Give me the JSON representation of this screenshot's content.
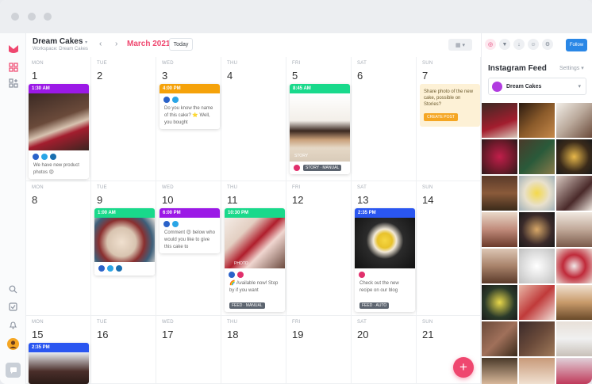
{
  "header": {
    "brand": "Dream Cakes",
    "workspace": "Workspace: Dream Cakes",
    "month": "March 2021",
    "today_label": "Today",
    "grid_icon": "grid-icon",
    "follow_label": "Follow"
  },
  "calendar": {
    "row1": {
      "mon": {
        "wd": "MON",
        "day": "1"
      },
      "tue": {
        "wd": "TUE",
        "day": "2"
      },
      "wed": {
        "wd": "WED",
        "day": "3"
      },
      "thu": {
        "wd": "THU",
        "day": "4"
      },
      "fri": {
        "wd": "FRI",
        "day": "5"
      },
      "sat": {
        "wd": "SAT",
        "day": "6"
      },
      "sun": {
        "wd": "SUN",
        "day": "7"
      }
    },
    "row2": {
      "mon": {
        "wd": "MON",
        "day": "8"
      },
      "tue": {
        "wd": "TUE",
        "day": "9"
      },
      "wed": {
        "wd": "WED",
        "day": "10"
      },
      "thu": {
        "wd": "THU",
        "day": "11"
      },
      "fri": {
        "wd": "FRI",
        "day": "12"
      },
      "sat": {
        "wd": "SAT",
        "day": "13"
      },
      "sun": {
        "wd": "SUN",
        "day": "14"
      }
    },
    "row3": {
      "mon": {
        "wd": "MON",
        "day": "15"
      },
      "tue": {
        "wd": "TUE",
        "day": "16"
      },
      "wed": {
        "wd": "WED",
        "day": "17"
      },
      "thu": {
        "wd": "THU",
        "day": "18"
      },
      "fri": {
        "wd": "FRI",
        "day": "19"
      },
      "sat": {
        "wd": "SAT",
        "day": "20"
      },
      "sun": {
        "wd": "SUN",
        "day": "21"
      }
    }
  },
  "posts": {
    "p1": {
      "time": "1:30 AM",
      "color": "#9b19e6",
      "caption": "We have new product photos 😍"
    },
    "p2": {
      "time": "4:00 PM",
      "color": "#f5a20a",
      "caption": "Do you know the name of this cake? ⭐ Well, you bought"
    },
    "p3": {
      "time": "8:45 AM",
      "color": "#19d98b",
      "badge": "STORY · MANUAL",
      "overlay": "STORY"
    },
    "p4": {
      "time": "1:00 AM",
      "color": "#19d98b"
    },
    "p5": {
      "time": "6:00 PM",
      "color": "#9b19e6",
      "caption": "Comment 😍 below who would you like to give this cake to"
    },
    "p6": {
      "time": "10:30 PM",
      "color": "#19d98b",
      "caption": "🌈 Available now! Stop by if you want",
      "badge": "FEED · MANUAL",
      "overlay": "PHOTO"
    },
    "p7": {
      "time": "2:35 PM",
      "color": "#2a56f0",
      "caption": "Check out the new recipe on our blog",
      "badge": "FEED · AUTO"
    },
    "p8": {
      "time": "2:35 PM",
      "color": "#2a56f0"
    }
  },
  "note": {
    "text": "Share photo of the new cake, possible on Stories?",
    "button": "CREATE POST"
  },
  "instagram": {
    "title": "Instagram Feed",
    "settings": "Settings",
    "account": "Dream Cakes"
  },
  "colors": {
    "brand_pink": "#ef476f",
    "follow_blue": "#2a87e6"
  }
}
